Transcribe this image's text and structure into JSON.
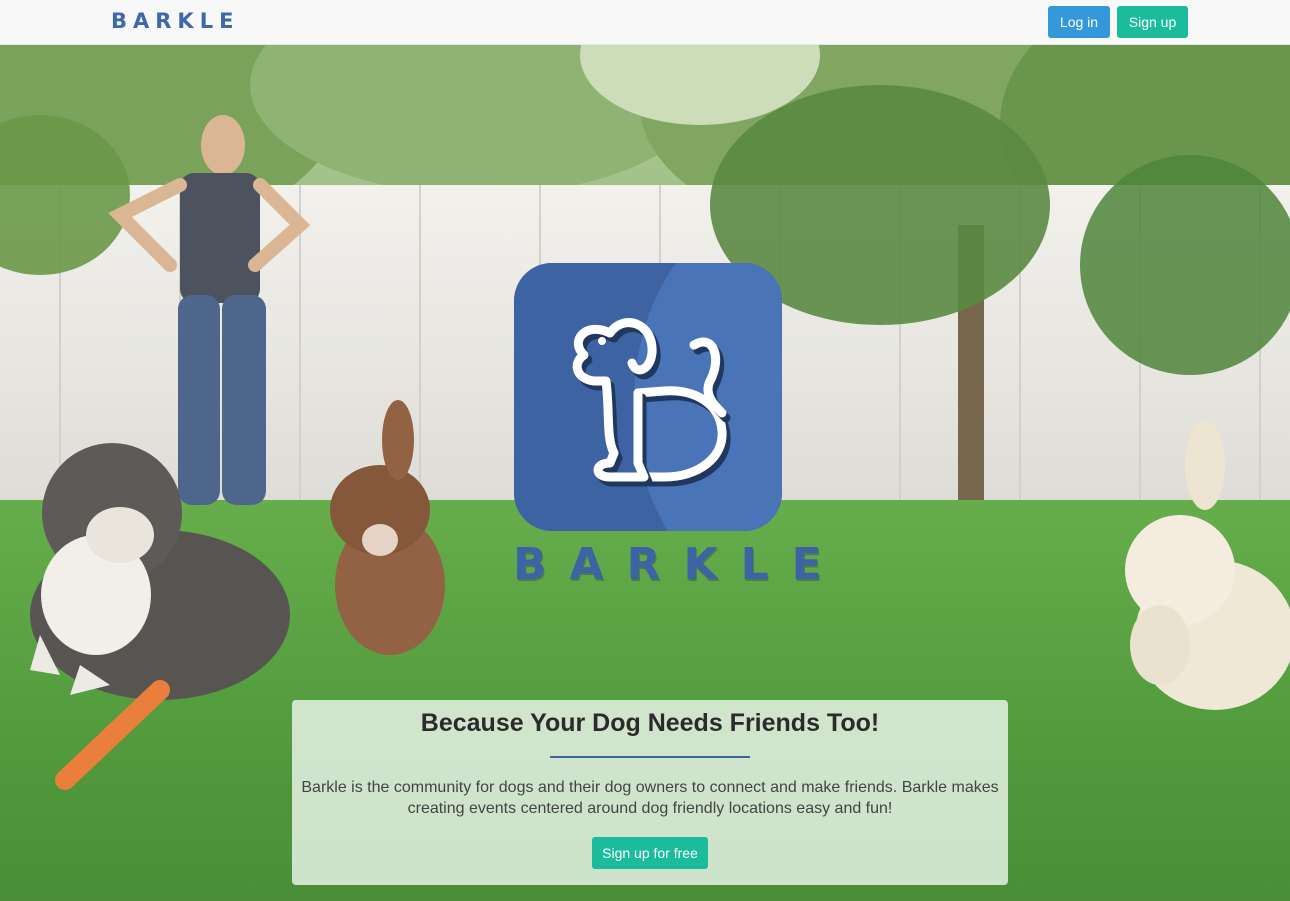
{
  "navbar": {
    "brand": "BARKLE",
    "login_label": "Log in",
    "signup_label": "Sign up"
  },
  "hero": {
    "logo_wordmark": "BARKLE",
    "logo_icon": "dog-icon"
  },
  "card": {
    "title": "Because Your Dog Needs Friends Too!",
    "description": "Barkle is the community for dogs and their dog owners to connect and make friends. Barkle makes creating events centered around dog friendly locations easy and fun!",
    "cta_label": "Sign up for free"
  },
  "colors": {
    "brand_blue": "#3e63a3",
    "login_button": "#3498db",
    "signup_button": "#1abc9c"
  }
}
